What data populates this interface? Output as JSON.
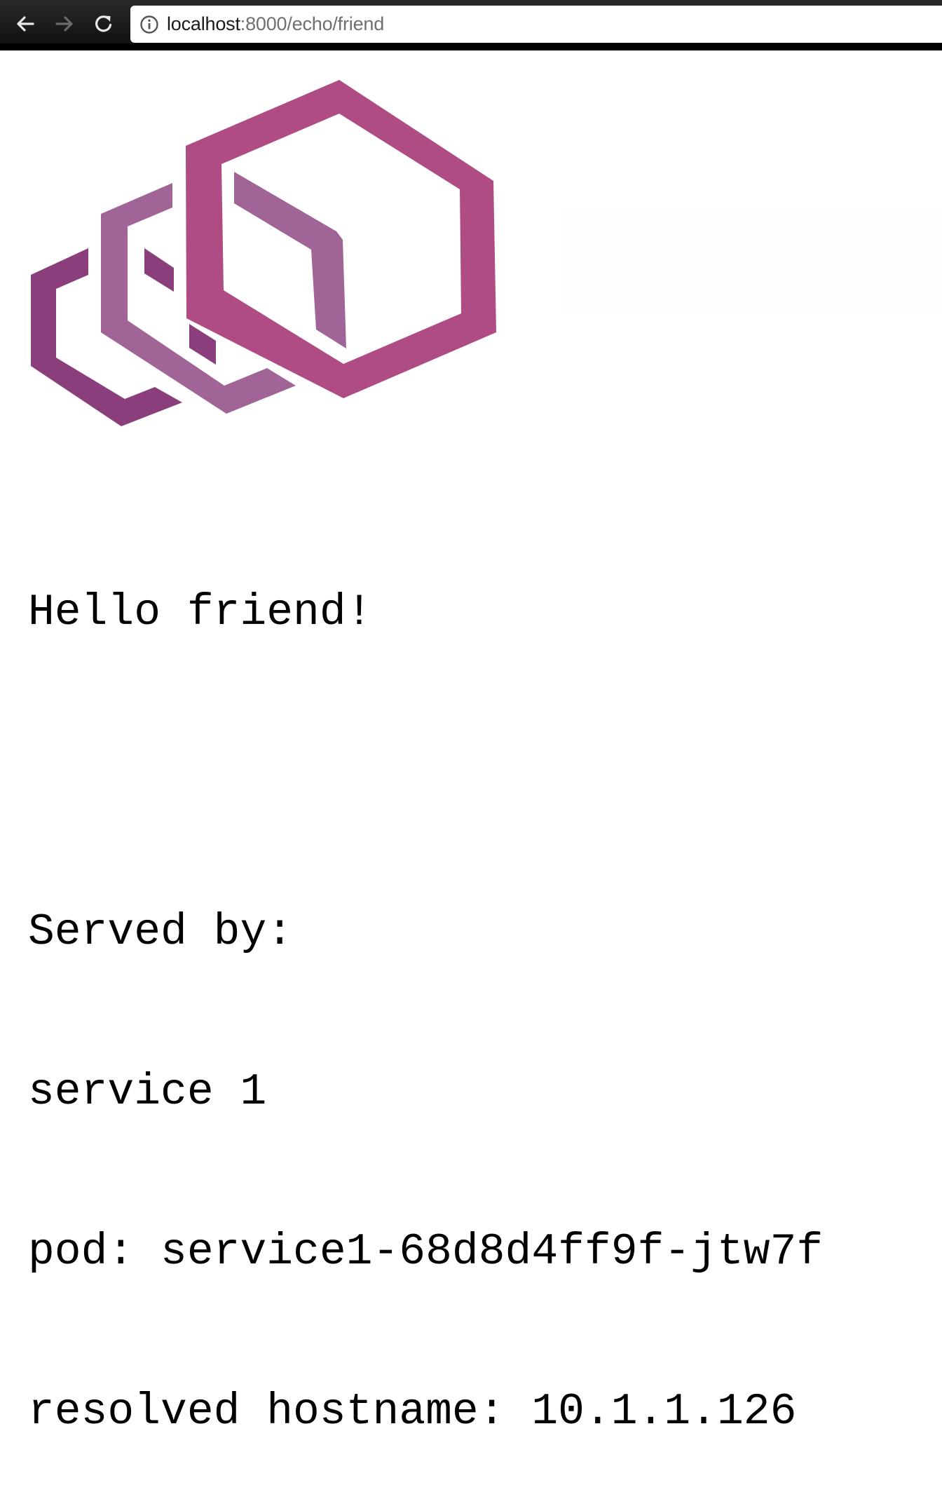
{
  "browser": {
    "url_host": "localhost",
    "url_rest": ":8000/echo/friend",
    "icons": {
      "back": "arrow-left-icon",
      "forward": "arrow-right-icon",
      "reload": "reload-icon",
      "site_info": "info-circle-icon"
    }
  },
  "page": {
    "logo": {
      "icon": "envoy-logo",
      "colors": {
        "primary": "#B04C84",
        "secondary": "#A06596",
        "tertiary": "#8A3F7C"
      }
    },
    "greeting": "Hello friend!",
    "served_by_label": "Served by:",
    "service": "service 1",
    "pod_line": "pod: service1-68d8d4ff9f-jtw7f",
    "hostname_line": "resolved hostname: 10.1.1.126"
  }
}
